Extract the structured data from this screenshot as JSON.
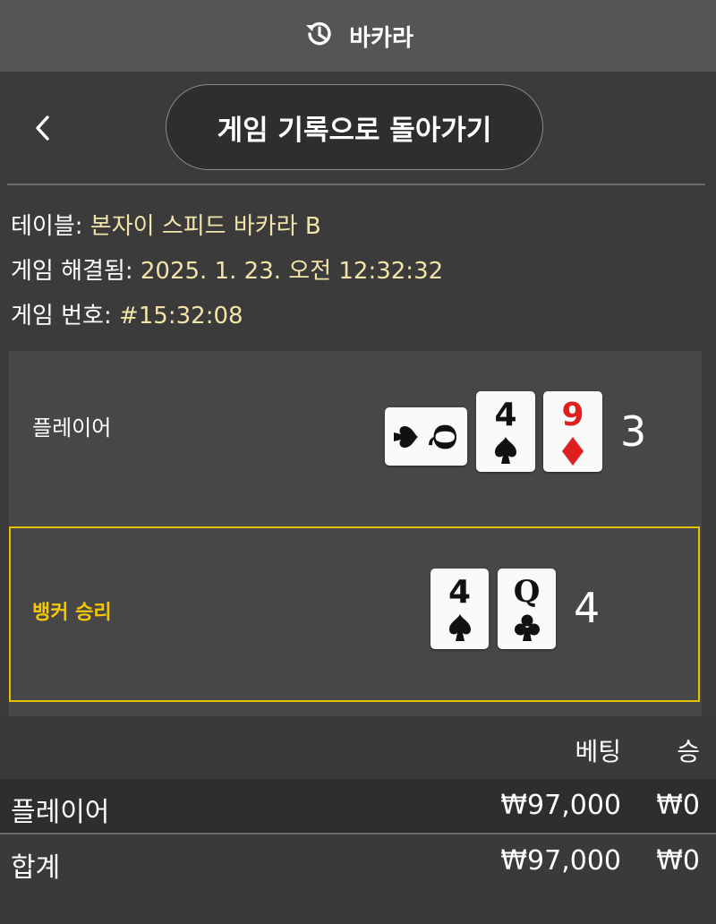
{
  "header": {
    "title": "바카라",
    "icon": "history-icon"
  },
  "nav": {
    "back_icon": "chevron-left-icon",
    "back_to_history_label": "게임 기록으로 돌아가기"
  },
  "game_info": {
    "table_label": "테이블:",
    "table_value": "본자이 스피드 바카라 B",
    "resolved_label": "게임 해결됨:",
    "resolved_value": "2025. 1. 23. 오전 12:32:32",
    "number_label": "게임 번호:",
    "number_value": "#15:32:08"
  },
  "result": {
    "player": {
      "label": "플레이어",
      "cards": [
        {
          "rank": "Q",
          "suit": "spade",
          "color": "#111111",
          "orientation": "sideways"
        },
        {
          "rank": "4",
          "suit": "spade",
          "color": "#111111"
        },
        {
          "rank": "9",
          "suit": "diamond",
          "color": "#e02020"
        }
      ],
      "score": "3"
    },
    "banker": {
      "label": "뱅커 승리",
      "label_color": "#f5c800",
      "cards": [
        {
          "rank": "4",
          "suit": "spade",
          "color": "#111111"
        },
        {
          "rank": "Q",
          "suit": "club",
          "color": "#111111"
        }
      ],
      "score": "4"
    }
  },
  "bets": {
    "col_bet": "베팅",
    "col_win": "승",
    "rows": [
      {
        "label": "플레이어",
        "bet": "₩97,000",
        "win": "₩0"
      }
    ],
    "total": {
      "label": "합계",
      "bet": "₩97,000",
      "win": "₩0"
    }
  },
  "colors": {
    "accent_yellow": "#e5c100",
    "info_value": "#f2e3a8"
  }
}
